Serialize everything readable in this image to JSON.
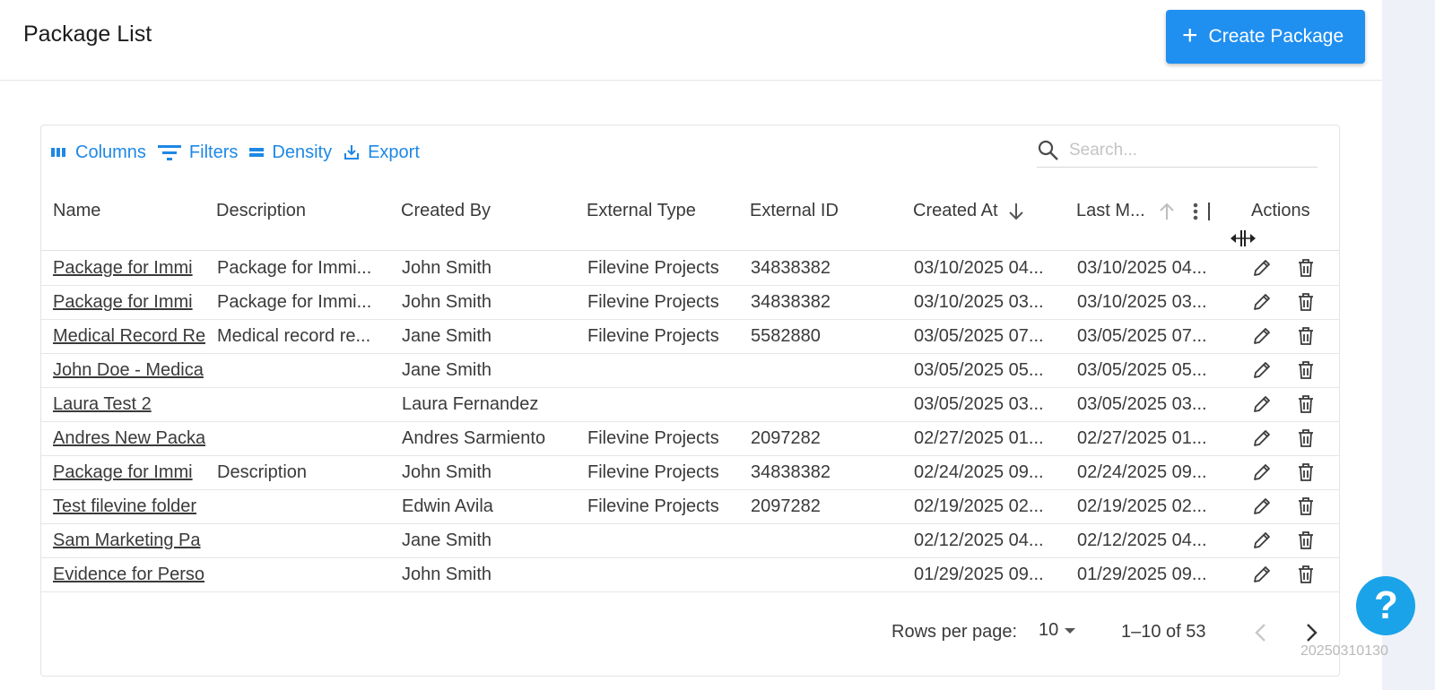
{
  "header": {
    "title": "Package List",
    "create_label": "Create Package"
  },
  "toolbar": {
    "columns": "Columns",
    "filters": "Filters",
    "density": "Density",
    "export": "Export"
  },
  "search": {
    "placeholder": "Search..."
  },
  "columns": {
    "name": "Name",
    "description": "Description",
    "created_by": "Created By",
    "external_type": "External Type",
    "external_id": "External ID",
    "created_at": "Created At",
    "last_modified": "Last M...",
    "actions": "Actions"
  },
  "rows": [
    {
      "name": "Package for Immi",
      "description": "Package for Immi...",
      "created_by": "John Smith",
      "external_type": "Filevine Projects",
      "external_id": "34838382",
      "created_at": "03/10/2025 04...",
      "last_modified": "03/10/2025 04..."
    },
    {
      "name": "Package for Immi",
      "description": "Package for Immi...",
      "created_by": "John Smith",
      "external_type": "Filevine Projects",
      "external_id": "34838382",
      "created_at": "03/10/2025 03...",
      "last_modified": "03/10/2025 03..."
    },
    {
      "name": "Medical Record Re",
      "description": "Medical record re...",
      "created_by": "Jane Smith",
      "external_type": "Filevine Projects",
      "external_id": "5582880",
      "created_at": "03/05/2025 07...",
      "last_modified": "03/05/2025 07..."
    },
    {
      "name": "John Doe - Medica",
      "description": "",
      "created_by": "Jane Smith",
      "external_type": "",
      "external_id": "",
      "created_at": "03/05/2025 05...",
      "last_modified": "03/05/2025 05..."
    },
    {
      "name": "Laura Test 2",
      "description": "",
      "created_by": "Laura Fernandez",
      "external_type": "",
      "external_id": "",
      "created_at": "03/05/2025 03...",
      "last_modified": "03/05/2025 03..."
    },
    {
      "name": "Andres New Packa",
      "description": "",
      "created_by": "Andres Sarmiento",
      "external_type": "Filevine Projects",
      "external_id": "2097282",
      "created_at": "02/27/2025 01...",
      "last_modified": "02/27/2025 01..."
    },
    {
      "name": "Package for Immi",
      "description": "Description",
      "created_by": "John Smith",
      "external_type": "Filevine Projects",
      "external_id": "34838382",
      "created_at": "02/24/2025 09...",
      "last_modified": "02/24/2025 09..."
    },
    {
      "name": "Test filevine folder",
      "description": "",
      "created_by": "Edwin Avila",
      "external_type": "Filevine Projects",
      "external_id": "2097282",
      "created_at": "02/19/2025 02...",
      "last_modified": "02/19/2025 02..."
    },
    {
      "name": "Sam Marketing Pa",
      "description": "",
      "created_by": "Jane Smith",
      "external_type": "",
      "external_id": "",
      "created_at": "02/12/2025 04...",
      "last_modified": "02/12/2025 04..."
    },
    {
      "name": "Evidence for Perso",
      "description": "",
      "created_by": "John Smith",
      "external_type": "",
      "external_id": "",
      "created_at": "01/29/2025 09...",
      "last_modified": "01/29/2025 09..."
    }
  ],
  "footer": {
    "rows_per_page_label": "Rows per page:",
    "rows_per_page_value": "10",
    "range": "1–10 of 53"
  },
  "help": {
    "label": "?"
  },
  "timestamp": "20250310130"
}
